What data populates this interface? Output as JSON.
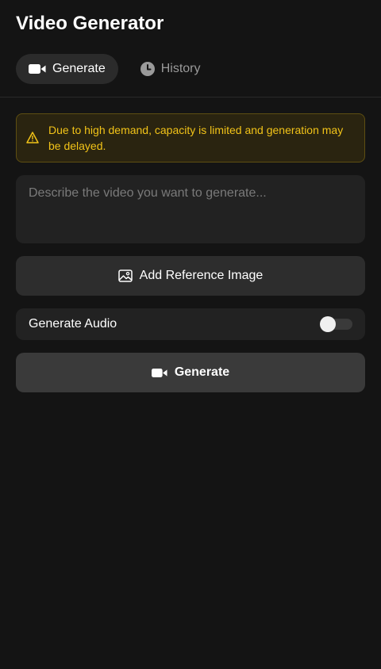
{
  "app": {
    "title": "Video Generator"
  },
  "tabs": [
    {
      "label": "Generate",
      "icon": "video-camera-icon",
      "active": true
    },
    {
      "label": "History",
      "icon": "clock-icon",
      "active": false
    }
  ],
  "banner": {
    "icon": "warning-icon",
    "message": "Due to high demand, capacity is limited and generation may be delayed.",
    "color": "#f2c318"
  },
  "prompt": {
    "placeholder": "Describe the video you want to generate...",
    "value": ""
  },
  "reference": {
    "label": "Add Reference Image",
    "icon": "image-icon"
  },
  "audio": {
    "label": "Generate Audio",
    "enabled": false
  },
  "generate": {
    "label": "Generate",
    "icon": "video-camera-icon"
  }
}
